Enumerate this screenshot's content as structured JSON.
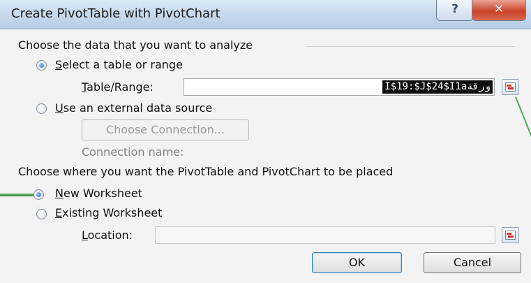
{
  "window": {
    "title": "Create PivotTable with PivotChart",
    "help_glyph": "?",
    "close_glyph": "✕"
  },
  "analyze": {
    "heading": "Choose the data that you want to analyze",
    "select_range": {
      "label_accel": "S",
      "label_rest": "elect a table or range",
      "checked": true
    },
    "table_range": {
      "label_accel": "T",
      "label_rest": "able/Range:",
      "value": "I$19:$J$24$I1aورقة"
    },
    "external_source": {
      "label_accel": "U",
      "label_rest": "se an external data source",
      "checked": false
    },
    "choose_connection_label": "Choose Connection...",
    "connection_name_label": "Connection name:"
  },
  "placement": {
    "heading": "Choose where you want the PivotTable and PivotChart to be placed",
    "new_worksheet": {
      "label_accel": "N",
      "label_rest": "ew Worksheet",
      "checked": true
    },
    "existing_worksheet": {
      "label_accel": "E",
      "label_rest": "xisting Worksheet",
      "checked": false
    },
    "location": {
      "label_accel": "L",
      "label_rest": "ocation:",
      "value": ""
    }
  },
  "buttons": {
    "ok": "OK",
    "cancel": "Cancel"
  },
  "icons": {
    "range_picker": "range-select-icon",
    "location_picker": "range-select-icon"
  },
  "colors": {
    "title_gradient_top": "#dde9f6",
    "close_button": "#c9442a",
    "selection": "#0f0f0f",
    "annotation_green": "#4f9d4f"
  }
}
